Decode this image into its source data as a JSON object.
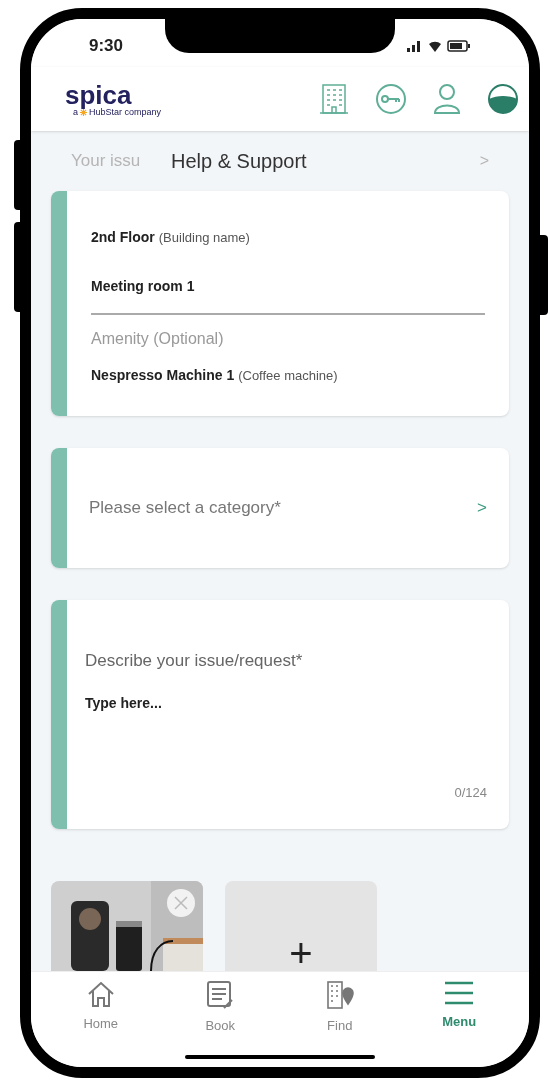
{
  "status_bar": {
    "time": "9:30"
  },
  "header": {
    "logo": "spica",
    "tagline_prefix": "a",
    "tagline": "HubStar company"
  },
  "page": {
    "title": "Help & Support",
    "behind_field": "Your issu",
    "behind_chevron": ">"
  },
  "location_card": {
    "floor": "2nd Floor",
    "building": "(Building name)",
    "room": "Meeting room 1",
    "amenity_label": "Amenity (Optional)",
    "amenity": "Nespresso Machine 1",
    "amenity_type": "(Coffee machine)"
  },
  "category": {
    "placeholder": "Please select a category*",
    "chevron": ">"
  },
  "issue": {
    "label": "Describe your issue/request*",
    "placeholder": "Type here...",
    "counter": "0/124"
  },
  "attachments": [
    {
      "kind": "picture"
    },
    {
      "kind": "add",
      "label": "+"
    }
  ],
  "tabs": [
    {
      "label": "Home",
      "kind": "home",
      "selected": false
    },
    {
      "label": "Book",
      "kind": "book",
      "selected": false
    },
    {
      "label": "Find",
      "kind": "find",
      "selected": false
    },
    {
      "label": "Menu",
      "kind": "menu",
      "selected": true
    }
  ]
}
